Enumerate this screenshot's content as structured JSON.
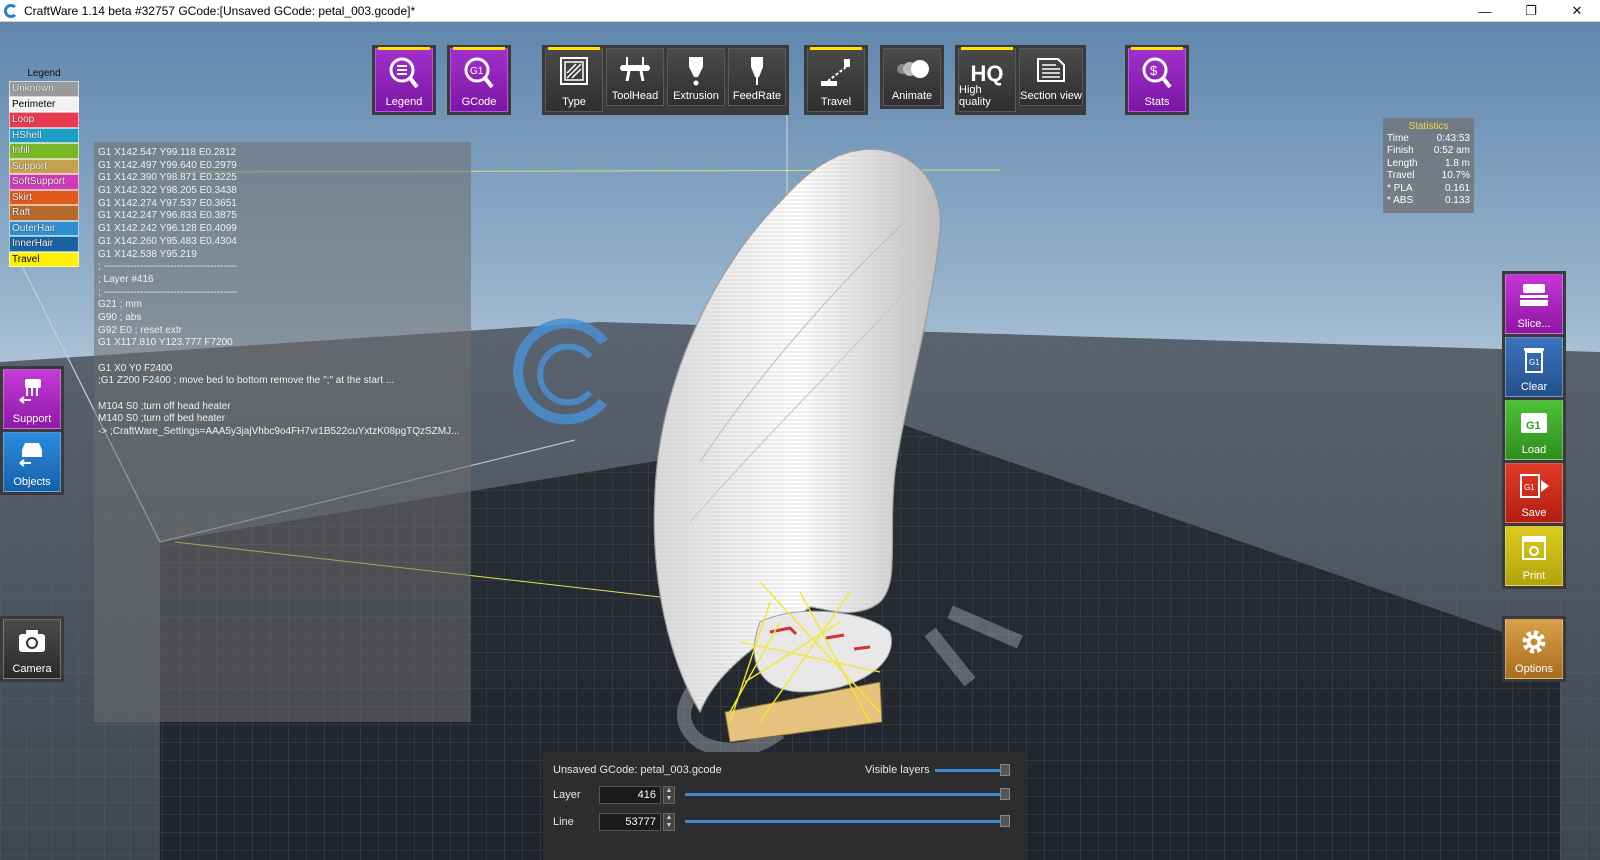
{
  "window": {
    "title": "CraftWare 1.14 beta #32757   GCode:[Unsaved GCode: petal_003.gcode]*",
    "minimize": "—",
    "maximize": "❐",
    "close": "✕"
  },
  "legend": {
    "title": "Legend",
    "items": [
      {
        "label": "Unknown",
        "color": "#9a9a9a"
      },
      {
        "label": "Perimeter",
        "color": "#f2f2f2",
        "text": "#000000"
      },
      {
        "label": "Loop",
        "color": "#e8394f"
      },
      {
        "label": "HShell",
        "color": "#1e9ec7"
      },
      {
        "label": "Infill",
        "color": "#78b826"
      },
      {
        "label": "Support",
        "color": "#c4a04f"
      },
      {
        "label": "SoftSupport",
        "color": "#d13ab7"
      },
      {
        "label": "Skirt",
        "color": "#e05a1a"
      },
      {
        "label": "Raft",
        "color": "#b7682b"
      },
      {
        "label": "OuterHair",
        "color": "#2c8fcf"
      },
      {
        "label": "InnerHair",
        "color": "#1a62a0"
      },
      {
        "label": "Travel",
        "color": "#fff200",
        "text": "#000000"
      }
    ]
  },
  "toolbar": {
    "legend": "Legend",
    "gcode": "GCode",
    "gcode_badge": "G1",
    "type": "Type",
    "toolhead": "ToolHead",
    "extrusion": "Extrusion",
    "feedrate": "FeedRate",
    "travel": "Travel",
    "animate": "Animate",
    "high_quality": "High quality",
    "hq_badge": "HQ",
    "section_view": "Section view",
    "stats": "Stats"
  },
  "left_buttons": {
    "support": "Support",
    "objects": "Objects",
    "camera": "Camera"
  },
  "right_buttons": {
    "slice": "Slice...",
    "clear": "Clear",
    "load": "Load",
    "save": "Save",
    "print": "Print",
    "options": "Options",
    "g1_badge": "G1"
  },
  "gcode_lines": [
    "G1 X142.547 Y99.118 E0.2812",
    "G1 X142.497 Y99.640 E0.2979",
    "G1 X142.390 Y98.871 E0.3225",
    "G1 X142.322 Y98.205 E0.3438",
    "G1 X142.274 Y97.537 E0.3651",
    "G1 X142.247 Y96.833 E0.3875",
    "G1 X142.242 Y96.128 E0.4099",
    "G1 X142.260 Y95.483 E0.4304",
    "G1 X142.538 Y95.219",
    "; ----------------------------------------",
    "; Layer #416",
    "; ----------------------------------------",
    "G21 ; mm",
    "G90 ; abs",
    "G92 E0 ; reset extr",
    "G1 X117.810 Y123.777 F7200",
    "",
    "G1 X0 Y0 F2400",
    ";G1 Z200 F2400 ; move bed to bottom remove the \";\" at the start ...",
    "",
    "M104 S0 ;turn off head heater",
    "M140 S0 ;turn off bed heater",
    "-> ;CraftWare_Settings=AAA5y3jajVhbc9o4FH7vr1B522cuYxtzK08pgTQzSZMJ..."
  ],
  "stats": {
    "title": "Statistics",
    "rows": [
      {
        "label": "Time",
        "value": "0:43:53"
      },
      {
        "label": "Finish",
        "value": "0:52 am"
      },
      {
        "label": "Length",
        "value": "1.8 m"
      },
      {
        "label": "Travel",
        "value": "10.7%"
      },
      {
        "label": "* PLA",
        "value": "0.161"
      },
      {
        "label": "* ABS",
        "value": "0.133"
      }
    ]
  },
  "layer_panel": {
    "file": "Unsaved GCode: petal_003.gcode",
    "visible_layers": "Visible layers",
    "layer_label": "Layer",
    "layer_value": "416",
    "line_label": "Line",
    "line_value": "53777",
    "visible_layers_fraction": 1.0,
    "layer_fraction": 1.0,
    "line_fraction": 1.0
  },
  "colors": {
    "accent_purple": "#8f22bf",
    "clear_blue": "#2f62a8",
    "load_green": "#3fae2a",
    "save_red": "#d12c1c",
    "print_yellow": "#d0bd13",
    "options_orange": "#c98a2c",
    "support_purple": "#b526c9",
    "objects_blue": "#1f78c9",
    "travel_yellow": "#fff200"
  }
}
